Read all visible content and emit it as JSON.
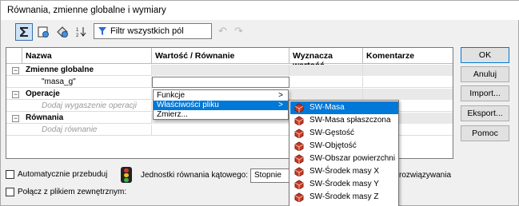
{
  "window": {
    "title": "Równania, zmienne globalne i wymiary"
  },
  "toolbar": {
    "filter_text": "Filtr wszystkich pól",
    "icons": [
      "sigma-view-icon",
      "sheet-view-icon",
      "dimension-view-icon",
      "sort-view-icon",
      "undo-icon",
      "redo-icon",
      "filter-icon"
    ]
  },
  "grid": {
    "columns": [
      "Nazwa",
      "Wartość / Równanie",
      "Wyznacza wartość",
      "Komentarze"
    ],
    "rows": [
      {
        "name": "Zmienne globalne",
        "kind": "section"
      },
      {
        "name": "\"masa_g\"",
        "kind": "item"
      },
      {
        "name": "Operacje",
        "kind": "section"
      },
      {
        "name": "Dodaj wygaszenie operacji",
        "kind": "hint"
      },
      {
        "name": "Równania",
        "kind": "section"
      },
      {
        "name": "Dodaj równanie",
        "kind": "hint"
      }
    ]
  },
  "context_menu": {
    "items": [
      {
        "label": "Funkcje",
        "arrow": ">"
      },
      {
        "label": "Właściwości pliku",
        "arrow": ">"
      },
      {
        "label": "Zmierz..."
      }
    ],
    "selected_index": 1
  },
  "submenu": {
    "items": [
      "SW-Masa",
      "SW-Masa spłaszczona",
      "SW-Gęstość",
      "SW-Objętość",
      "SW-Obszar powierzchni",
      "SW-Środek masy X",
      "SW-Środek masy Y",
      "SW-Środek masy Z"
    ],
    "selected_index": 0
  },
  "buttons": {
    "ok": "OK",
    "cancel": "Anuluj",
    "import": "Import...",
    "export": "Eksport...",
    "help": "Pomoc"
  },
  "bottom": {
    "auto_rebuild": "Automatycznie przebuduj",
    "angle_units_label": "Jednostki równania kątowego:",
    "angle_units_value": "Stopnie",
    "solve_suffix": "rozwiązywania",
    "link_file": "Połącz z plikiem zewnętrznym:"
  },
  "colors": {
    "accent": "#0078d7",
    "selection_text": "#ffffff"
  }
}
